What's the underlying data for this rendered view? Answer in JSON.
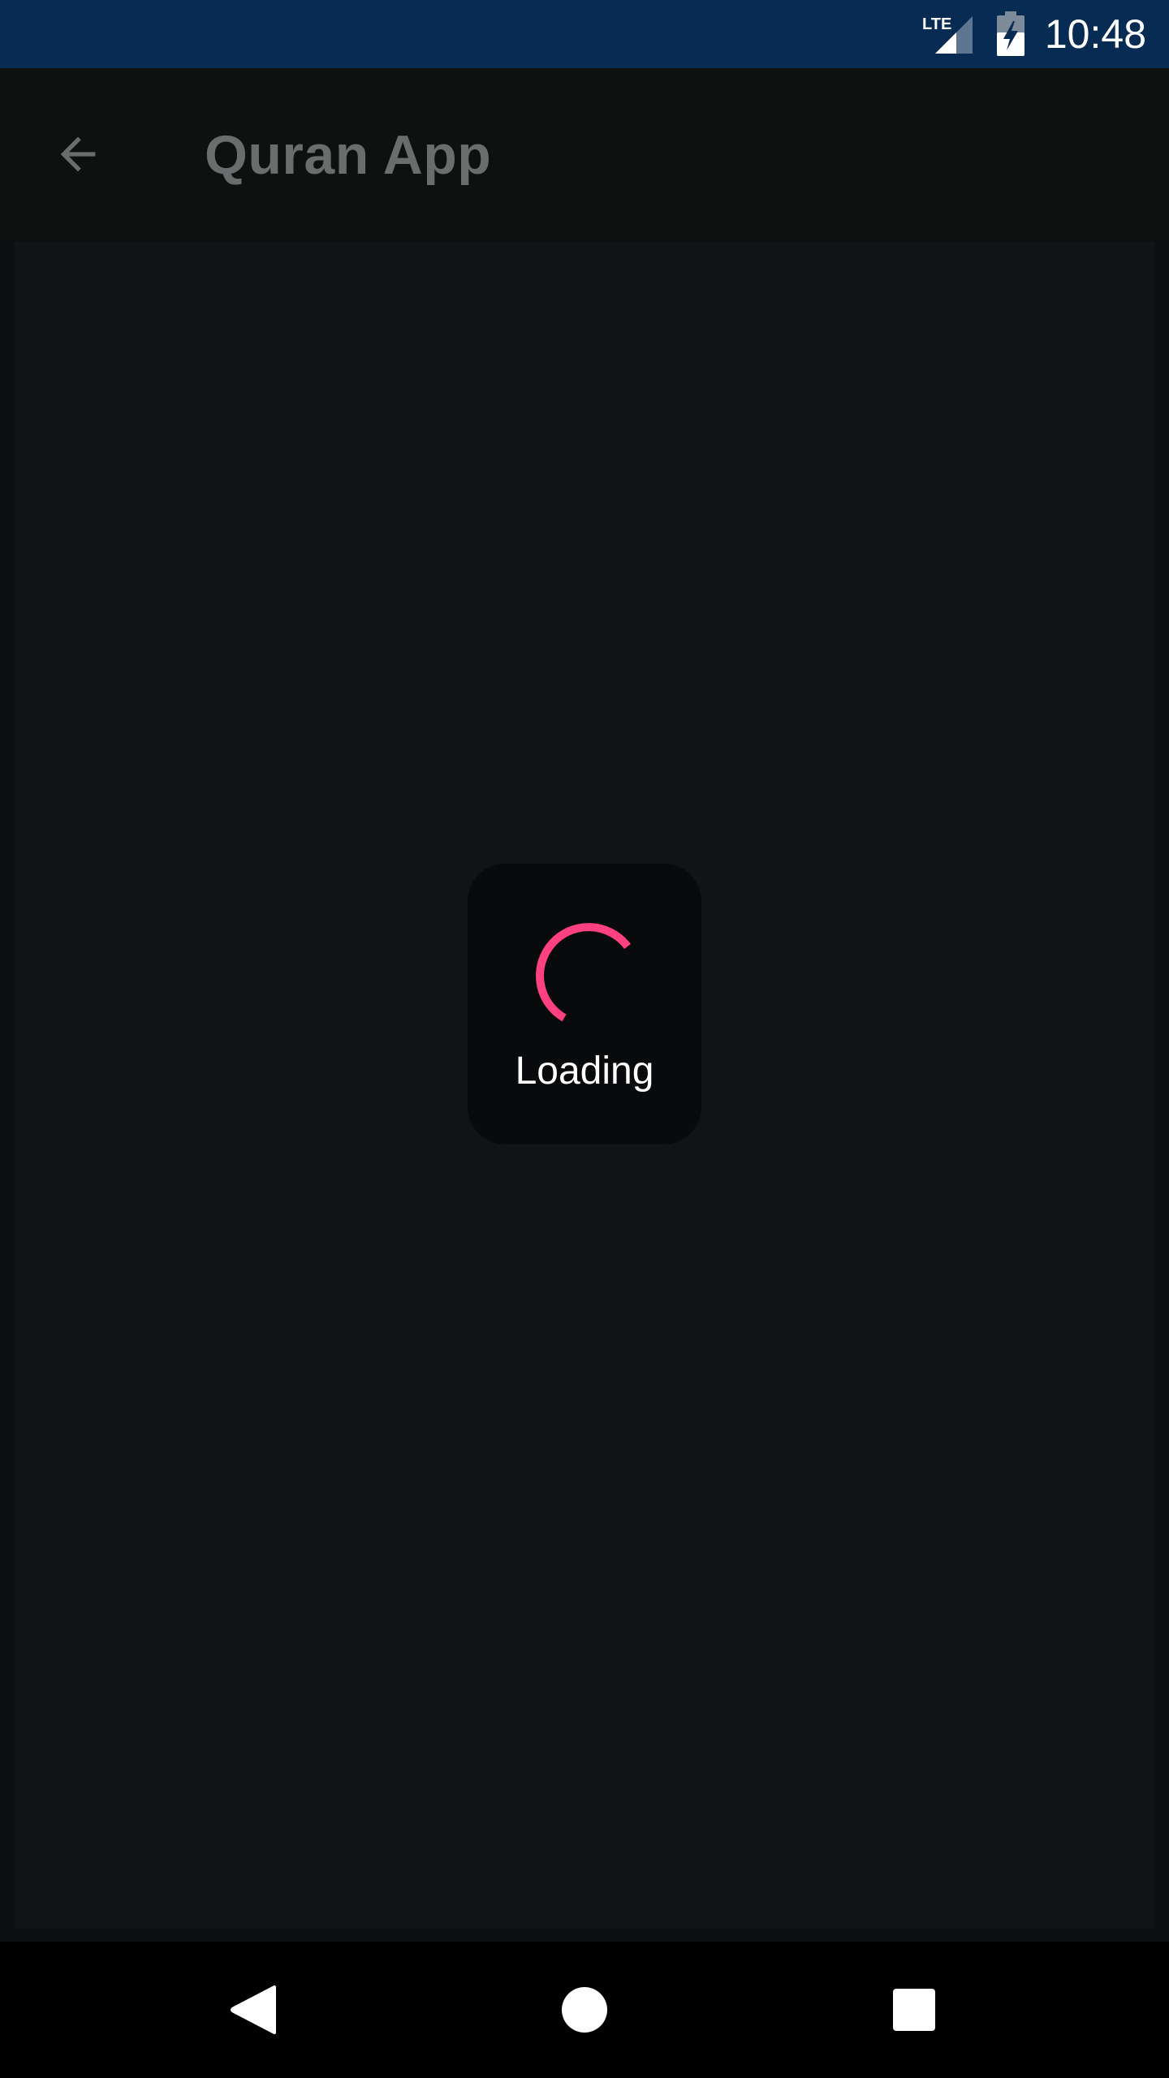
{
  "status_bar": {
    "network": "LTE",
    "time": "10:48",
    "background": "#082b53"
  },
  "app_bar": {
    "title": "Quran App",
    "back_icon": "arrow-back-icon"
  },
  "loading": {
    "label": "Loading",
    "spinner_color": "#ff4081"
  },
  "nav_bar": {
    "back_icon": "nav-back-icon",
    "home_icon": "nav-home-icon",
    "recents_icon": "nav-recents-icon"
  }
}
